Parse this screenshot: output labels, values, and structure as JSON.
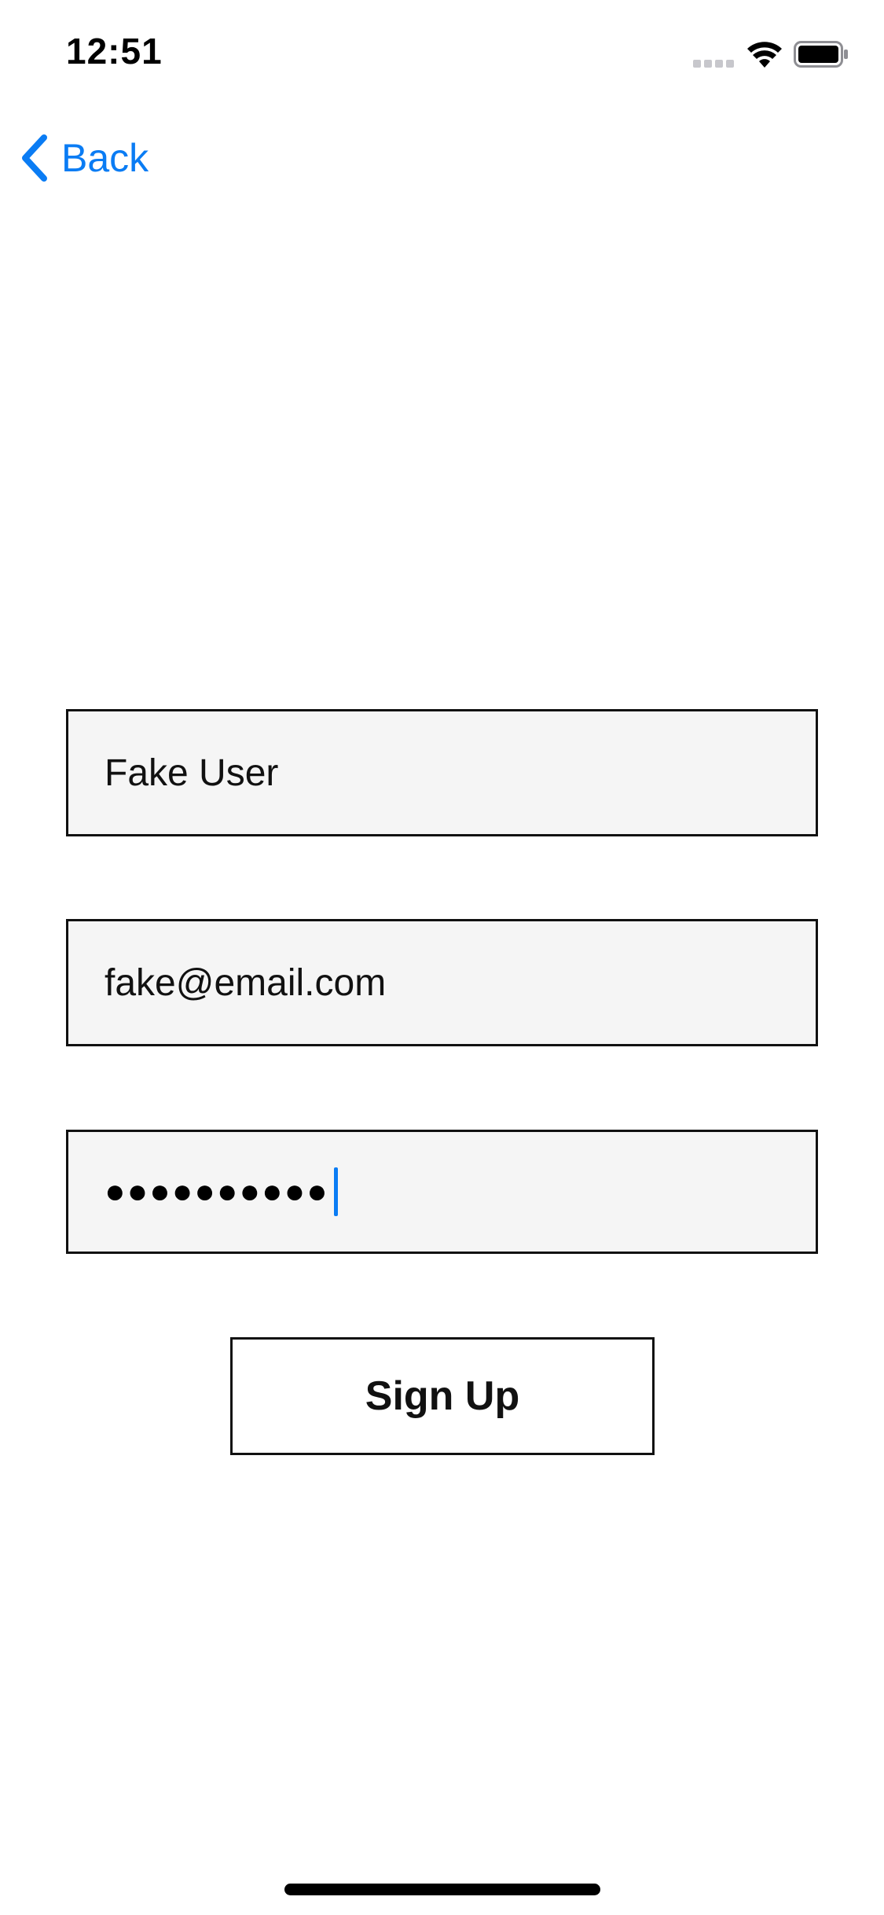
{
  "status_bar": {
    "time": "12:51",
    "icons": [
      "signal-icon",
      "wifi-icon",
      "battery-icon"
    ]
  },
  "nav": {
    "back_label": "Back",
    "back_icon": "chevron-left-icon"
  },
  "form": {
    "name_value": "Fake User",
    "email_value": "fake@email.com",
    "password_masked": "●●●●●●●●●●",
    "signup_label": "Sign Up"
  },
  "colors": {
    "accent": "#0a7cf4",
    "field_background": "#f5f5f5",
    "border": "#111111"
  }
}
